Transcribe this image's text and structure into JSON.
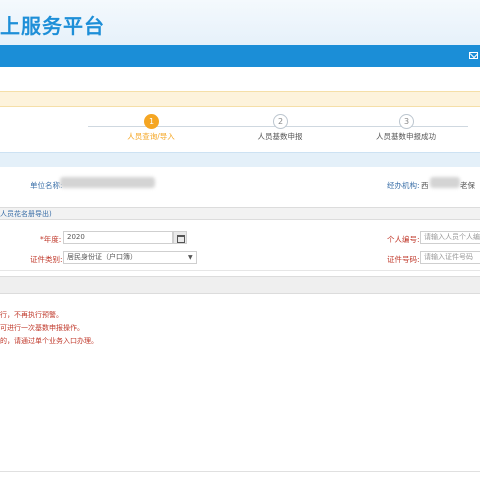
{
  "header": {
    "title": "上服务平台"
  },
  "steps": [
    {
      "number": "1",
      "label": "人员查询/导入",
      "color": "#f5a623"
    },
    {
      "number": "2",
      "label": "人员基数申报"
    },
    {
      "number": "3",
      "label": "人员基数申报成功"
    }
  ],
  "unit": {
    "name_label": "单位名称:",
    "agency_label": "经办机构:",
    "agency_prefix": "西",
    "agency_suffix": "老保"
  },
  "query": {
    "section_title": "人员花名册导出)",
    "year_label": "*年度:",
    "year_value": "2020",
    "person_id_label": "个人编号:",
    "person_id_placeholder": "请输入人员个人编号",
    "cert_type_label": "证件类别:",
    "cert_type_value": "居民身份证（户口簿）",
    "cert_no_label": "证件号码:",
    "cert_no_placeholder": "请输入证件号码"
  },
  "tips": [
    "行，不再执行预警。",
    "可进行一次基数申报操作。",
    "的，请通过单个业务入口办理。"
  ],
  "colors": {
    "brand": "#1b8ed7",
    "accent": "#f5a623",
    "error": "#c0392b"
  }
}
